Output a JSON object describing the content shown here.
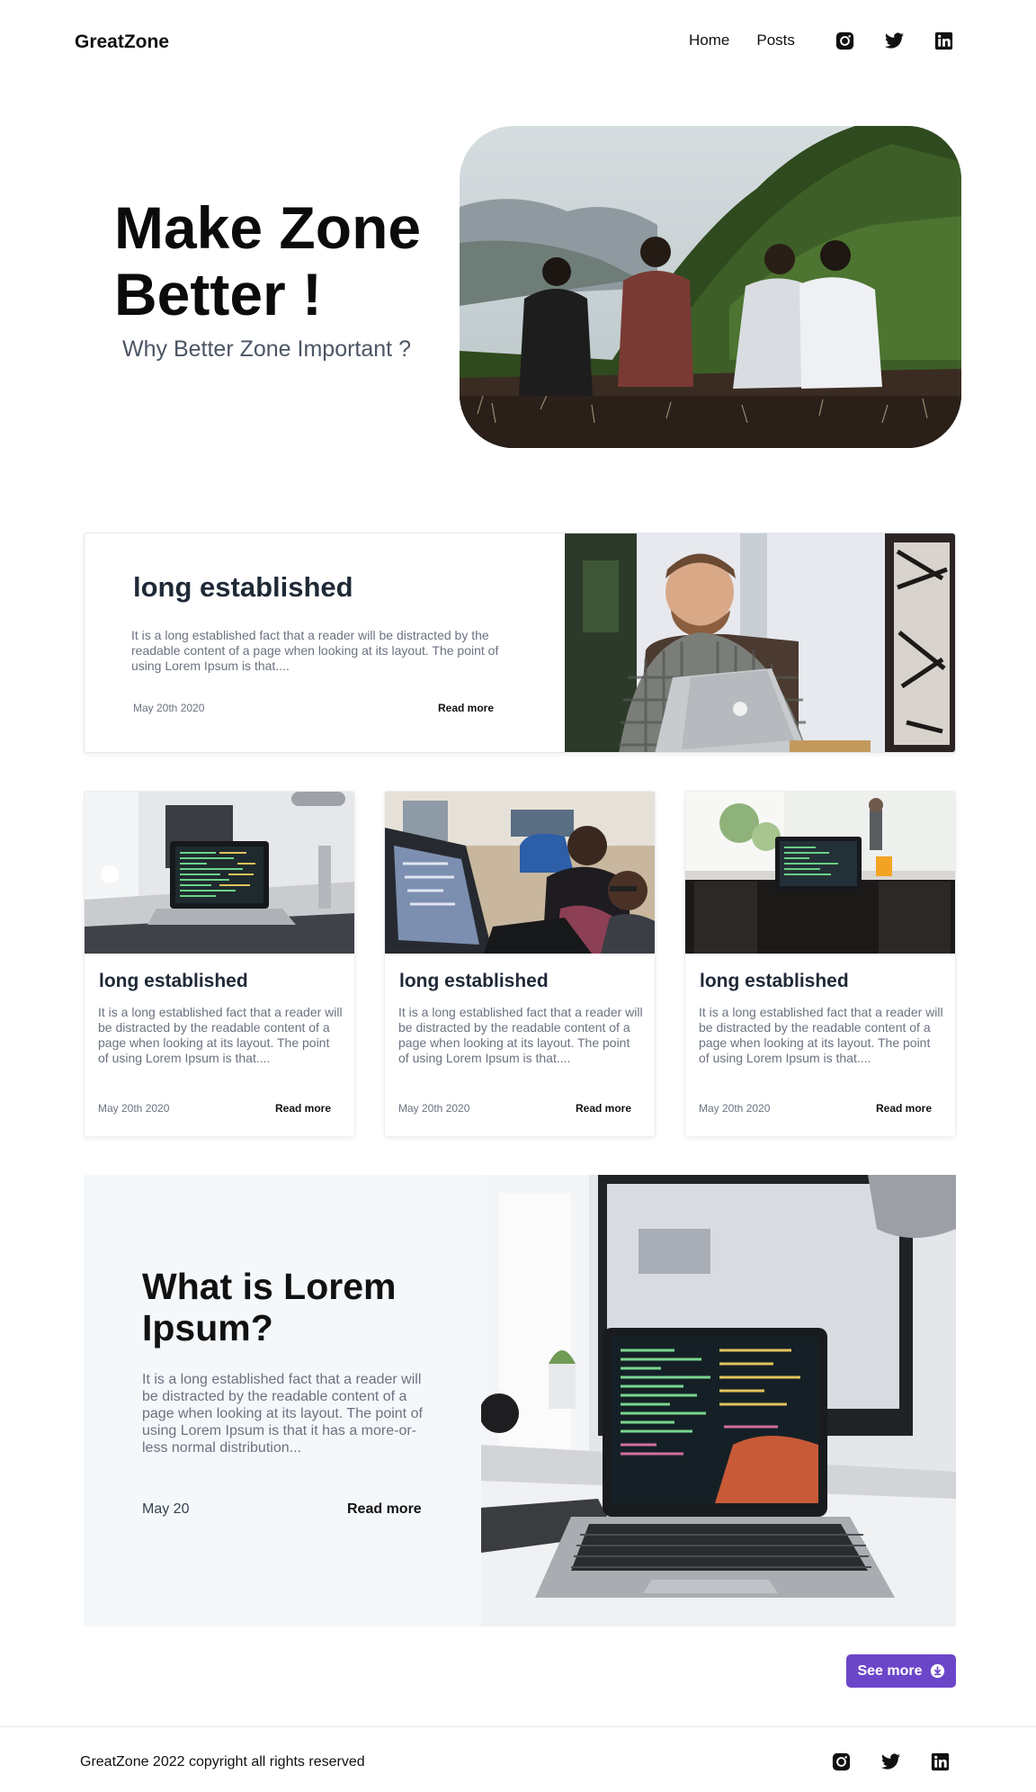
{
  "header": {
    "brand": "GreatZone",
    "nav": [
      {
        "label": "Home"
      },
      {
        "label": "Posts"
      }
    ],
    "social_icons": [
      "instagram-icon",
      "twitter-icon",
      "linkedin-icon"
    ]
  },
  "hero": {
    "title_line1": "Make Zone",
    "title_line2": "Better !",
    "subtitle": "Why Better Zone Important ?"
  },
  "featured": {
    "title": "long established",
    "text": "It is a long established fact that a reader will be distracted by the readable content of a page when looking at its layout. The point of using Lorem Ipsum is that....",
    "date": "May 20th 2020",
    "read_more": "Read more"
  },
  "cards": [
    {
      "title": "long established",
      "text": "It is a long established fact that a reader will be distracted by the readable content of a page when looking at its layout. The point of using Lorem Ipsum is that....",
      "date": "May 20th 2020",
      "read_more": "Read more"
    },
    {
      "title": "long established",
      "text": "It is a long established fact that a reader will be distracted by the readable content of a page when looking at its layout. The point of using Lorem Ipsum is that....",
      "date": "May 20th 2020",
      "read_more": "Read more"
    },
    {
      "title": "long established",
      "text": "It is a long established fact that a reader will be distracted by the readable content of a page when looking at its layout. The point of using Lorem Ipsum is that....",
      "date": "May 20th 2020",
      "read_more": "Read more"
    }
  ],
  "big_article": {
    "title": "What is Lorem Ipsum?",
    "text": "It is a long established fact that a reader will be distracted by the readable content of a page when looking at its layout. The point of using Lorem Ipsum is that it has a more-or-less normal distribution...",
    "date": "May 20",
    "read_more": "Read more"
  },
  "see_more": {
    "label": "See more",
    "icon": "download-circle-icon"
  },
  "footer": {
    "copyright": "GreatZone 2022 copyright all rights reserved",
    "social_icons": [
      "instagram-icon",
      "twitter-icon",
      "linkedin-icon"
    ]
  },
  "colors": {
    "accent": "#6c46c9",
    "text_muted": "#6b7280",
    "panel_bg": "#f5f8fb"
  }
}
